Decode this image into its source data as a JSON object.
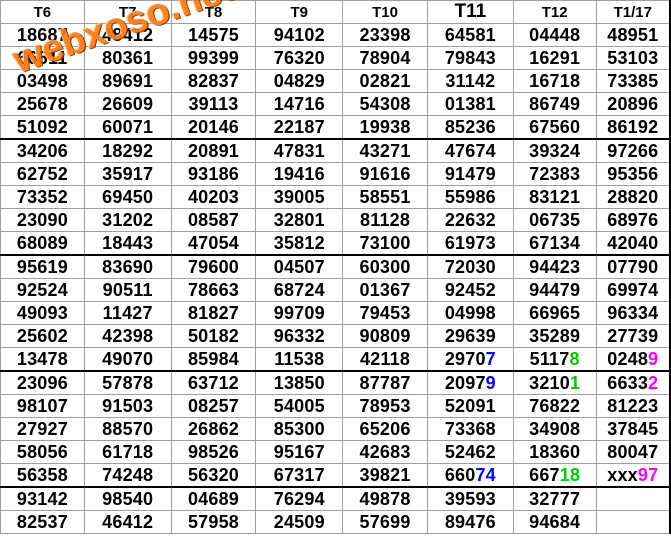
{
  "watermark": "webxoso.net",
  "colors": {
    "blue": "#0000ff",
    "green": "#00cc00",
    "magenta": "#ff00ff"
  },
  "headers": [
    "T6",
    "T7",
    "T8",
    "T9",
    "T10",
    "T11",
    "T12",
    "T1/17"
  ],
  "rows": [
    [
      [
        "18687"
      ],
      [
        "48412"
      ],
      [
        "14575"
      ],
      [
        "94102"
      ],
      [
        "23398"
      ],
      [
        "64581"
      ],
      [
        "04448"
      ],
      [
        "48951"
      ]
    ],
    [
      [
        "66611"
      ],
      [
        "80361"
      ],
      [
        "99399"
      ],
      [
        "76320"
      ],
      [
        "78904"
      ],
      [
        "79843"
      ],
      [
        "16291"
      ],
      [
        "53103"
      ]
    ],
    [
      [
        "03498"
      ],
      [
        "89691"
      ],
      [
        "82837"
      ],
      [
        "04829"
      ],
      [
        "02821"
      ],
      [
        "31142"
      ],
      [
        "16718"
      ],
      [
        "73385"
      ]
    ],
    [
      [
        "25678"
      ],
      [
        "26609"
      ],
      [
        "39113"
      ],
      [
        "14716"
      ],
      [
        "54308"
      ],
      [
        "01381"
      ],
      [
        "86749"
      ],
      [
        "20896"
      ]
    ],
    [
      [
        "51092"
      ],
      [
        "60071"
      ],
      [
        "20146"
      ],
      [
        "22187"
      ],
      [
        "19938"
      ],
      [
        "85236"
      ],
      [
        "67560"
      ],
      [
        "86192"
      ]
    ],
    [
      [
        "34206"
      ],
      [
        "18292"
      ],
      [
        "20891"
      ],
      [
        "47831"
      ],
      [
        "43271"
      ],
      [
        "47674"
      ],
      [
        "39324"
      ],
      [
        "97266"
      ]
    ],
    [
      [
        "62752"
      ],
      [
        "35917"
      ],
      [
        "93186"
      ],
      [
        "19416"
      ],
      [
        "91616"
      ],
      [
        "91479"
      ],
      [
        "72383"
      ],
      [
        "95356"
      ]
    ],
    [
      [
        "73352"
      ],
      [
        "69450"
      ],
      [
        "40203"
      ],
      [
        "39005"
      ],
      [
        "58551"
      ],
      [
        "55986"
      ],
      [
        "83121"
      ],
      [
        "28820"
      ]
    ],
    [
      [
        "23090"
      ],
      [
        "31202"
      ],
      [
        "08587"
      ],
      [
        "32801"
      ],
      [
        "81128"
      ],
      [
        "22632"
      ],
      [
        "06735"
      ],
      [
        "68976"
      ]
    ],
    [
      [
        "68089"
      ],
      [
        "18443"
      ],
      [
        "47054"
      ],
      [
        "35812"
      ],
      [
        "73100"
      ],
      [
        "61973"
      ],
      [
        "67134"
      ],
      [
        "42040"
      ]
    ],
    [
      [
        "95619"
      ],
      [
        "83690"
      ],
      [
        "79600"
      ],
      [
        "04507"
      ],
      [
        "60300"
      ],
      [
        "72030"
      ],
      [
        "94423"
      ],
      [
        "07790"
      ]
    ],
    [
      [
        "92524"
      ],
      [
        "90511"
      ],
      [
        "78663"
      ],
      [
        "68724"
      ],
      [
        "01367"
      ],
      [
        "92452"
      ],
      [
        "94479"
      ],
      [
        "69974"
      ]
    ],
    [
      [
        "49093"
      ],
      [
        "11427"
      ],
      [
        "81827"
      ],
      [
        "99709"
      ],
      [
        "79453"
      ],
      [
        "04998"
      ],
      [
        "66965"
      ],
      [
        "96334"
      ]
    ],
    [
      [
        "25602"
      ],
      [
        "42398"
      ],
      [
        "50182"
      ],
      [
        "96332"
      ],
      [
        "90809"
      ],
      [
        "29639"
      ],
      [
        "35289"
      ],
      [
        "27739"
      ]
    ],
    [
      [
        "13478"
      ],
      [
        "49070"
      ],
      [
        "85984"
      ],
      [
        "11538"
      ],
      [
        "42118"
      ],
      [
        "2970",
        "7",
        "blue"
      ],
      [
        "5117",
        "8",
        "green"
      ],
      [
        "0248",
        "9",
        "magenta"
      ]
    ],
    [
      [
        "23096"
      ],
      [
        "57878"
      ],
      [
        "63712"
      ],
      [
        "13850"
      ],
      [
        "87787"
      ],
      [
        "2097",
        "9",
        "blue"
      ],
      [
        "3210",
        "1",
        "green"
      ],
      [
        "6633",
        "2",
        "magenta"
      ]
    ],
    [
      [
        "98107"
      ],
      [
        "91503"
      ],
      [
        "08257"
      ],
      [
        "54005"
      ],
      [
        "78953"
      ],
      [
        "52091"
      ],
      [
        "76822"
      ],
      [
        "81223"
      ]
    ],
    [
      [
        "27927"
      ],
      [
        "88570"
      ],
      [
        "26862"
      ],
      [
        "85300"
      ],
      [
        "65206"
      ],
      [
        "73368"
      ],
      [
        "34908"
      ],
      [
        "37845"
      ]
    ],
    [
      [
        "58056"
      ],
      [
        "61718"
      ],
      [
        "98526"
      ],
      [
        "95167"
      ],
      [
        "42683"
      ],
      [
        "52462"
      ],
      [
        "18360"
      ],
      [
        "80047"
      ]
    ],
    [
      [
        "56358"
      ],
      [
        "74248"
      ],
      [
        "56320"
      ],
      [
        "67317"
      ],
      [
        "39821"
      ],
      [
        "660",
        "74",
        "blue"
      ],
      [
        "667",
        "18",
        "green"
      ],
      [
        "xxx",
        "97",
        "magenta"
      ]
    ],
    [
      [
        "93142"
      ],
      [
        "98540"
      ],
      [
        "04689"
      ],
      [
        "76294"
      ],
      [
        "49878"
      ],
      [
        "39593"
      ],
      [
        "32777"
      ],
      [
        ""
      ]
    ],
    [
      [
        "82537"
      ],
      [
        "46412"
      ],
      [
        "57958"
      ],
      [
        "24509"
      ],
      [
        "57699"
      ],
      [
        "89476"
      ],
      [
        "94684"
      ],
      [
        ""
      ]
    ]
  ]
}
